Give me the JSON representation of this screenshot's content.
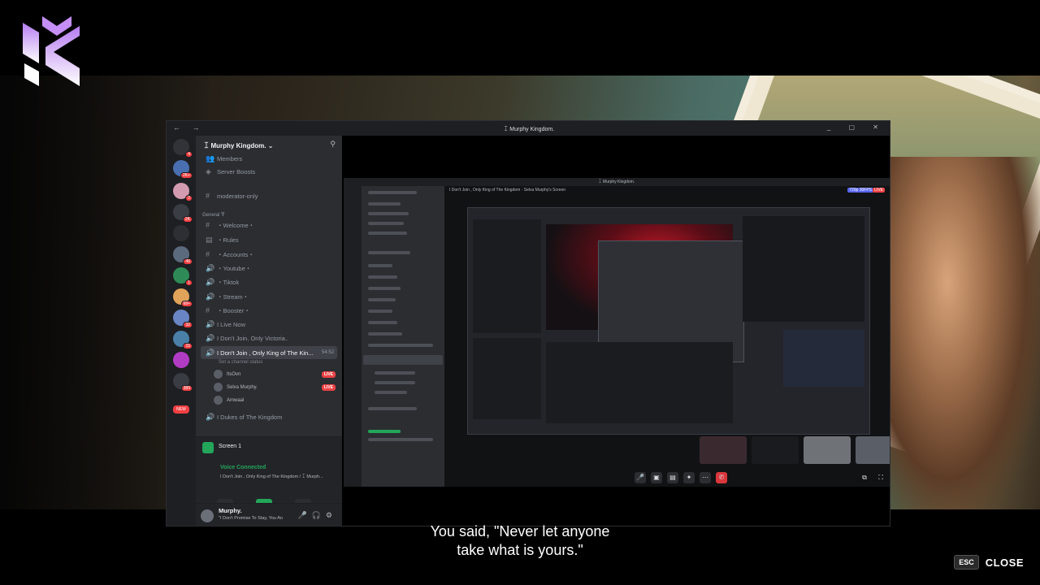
{
  "window": {
    "title": "ꀤ Murphy Kingdom.",
    "nav_arrows": "← →",
    "controls": "_ ▢ ✕"
  },
  "sidebar": {
    "server_name": "ꀤ Murphy Kingdom.",
    "top_items": [
      {
        "label": "Members",
        "glyph": "👥"
      },
      {
        "label": "Server Boosts",
        "glyph": "◈"
      }
    ],
    "channels_before": [
      {
        "label": "moderator-only",
        "glyph": "#"
      }
    ],
    "category_general": "General ꐗ",
    "channels": [
      {
        "label": "・Welcome・",
        "glyph": "#"
      },
      {
        "label": "・Rules",
        "glyph": "▤"
      },
      {
        "label": "・Accounts・",
        "glyph": "#"
      },
      {
        "label": "・Youtube・",
        "glyph": "🔊"
      },
      {
        "label": "・Tiktok",
        "glyph": "🔊"
      },
      {
        "label": "・Stream・",
        "glyph": "🔊"
      },
      {
        "label": "・Booster・",
        "glyph": "#"
      },
      {
        "label": "I Live Now",
        "glyph": "🔊"
      },
      {
        "label": "I Don't Join, Only Victoria..",
        "glyph": "🔊"
      }
    ],
    "active_voice_channel": {
      "label": "I Don't Join , Only King of The Kin...",
      "timer": "54:52",
      "status": "Set a channel status"
    },
    "voice_users": [
      {
        "name": "ItsOvn",
        "live": "LIVE"
      },
      {
        "name": "Selva Murphy.",
        "live": "LIVE"
      },
      {
        "name": "Amwaal",
        "live": ""
      }
    ],
    "after_channel": {
      "label": "I Dukes of The Kingdom",
      "glyph": "🔊"
    }
  },
  "voice_panel": {
    "screen_label": "Screen 1",
    "status": "Voice Connected",
    "detail": "I Don't Join , Only King of The Kingdom / ꀤ Murph..."
  },
  "user_panel": {
    "username": "Murphy.",
    "status": "\"I Don't Promise To Stay, You An"
  },
  "stream": {
    "header_channel": "I Don't Join , Only King of The Kingdom",
    "header_screen": "Selva Murphy's Screen",
    "quality": "720p 30FPS",
    "live": "LIVE",
    "nested_title": "ꀤ Murphy Kingdom."
  },
  "subtitle": {
    "line1": "You said, \"Never let anyone",
    "line2": "take what is yours.\""
  },
  "close_hint": {
    "key": "ESC",
    "label": "CLOSE"
  },
  "server_badges": [
    "4",
    "2K+",
    "2",
    "2K",
    "46",
    "1",
    "68+",
    "32",
    "15",
    "389",
    "NEW"
  ]
}
